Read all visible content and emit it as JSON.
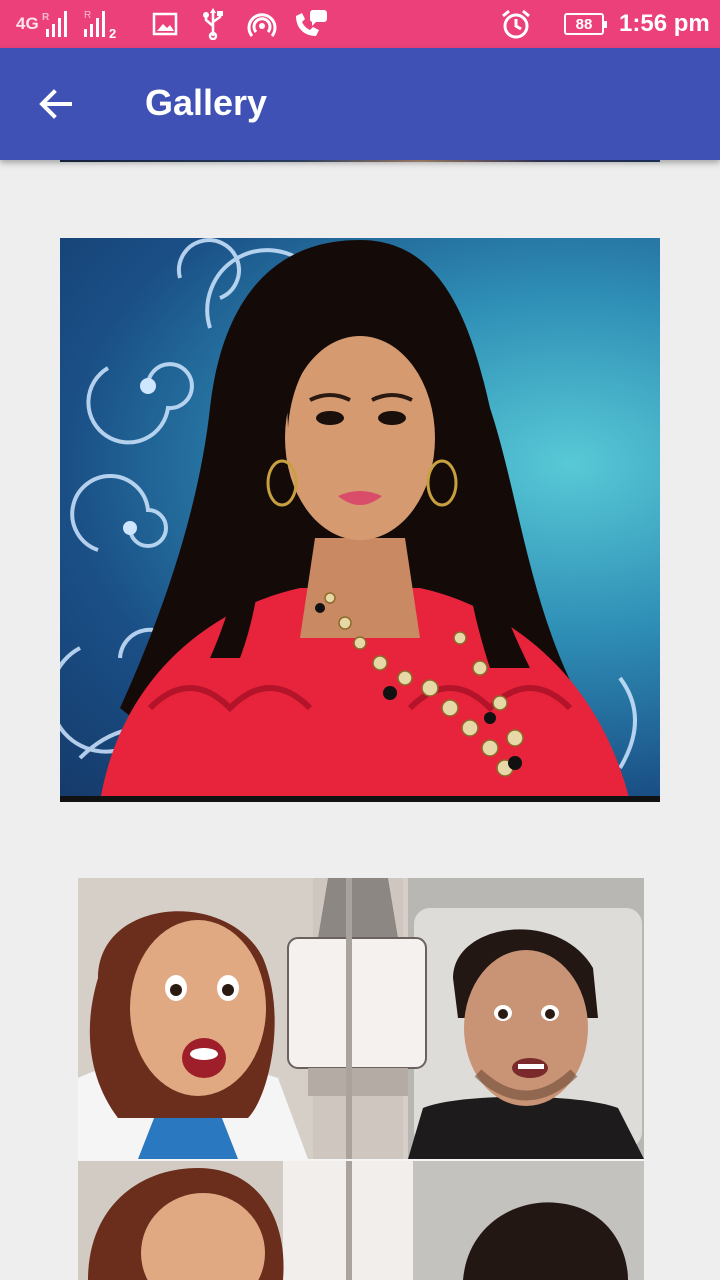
{
  "status_bar": {
    "network_label": "4G",
    "roaming_1": "R",
    "roaming_2": "R",
    "sim2_label": "2",
    "battery_level": "88",
    "time": "1:56 pm",
    "icons": [
      "image-icon",
      "usb-icon",
      "hotspot-icon",
      "call-icon",
      "alarm-icon",
      "battery-icon"
    ],
    "background_color": "#ec407a"
  },
  "app_bar": {
    "title": "Gallery",
    "back_icon": "arrow-back-icon",
    "background_color": "#3f51b5"
  },
  "gallery": {
    "items": [
      {
        "description": "portrait-photo"
      },
      {
        "description": "selfie-collage-photo"
      }
    ]
  }
}
